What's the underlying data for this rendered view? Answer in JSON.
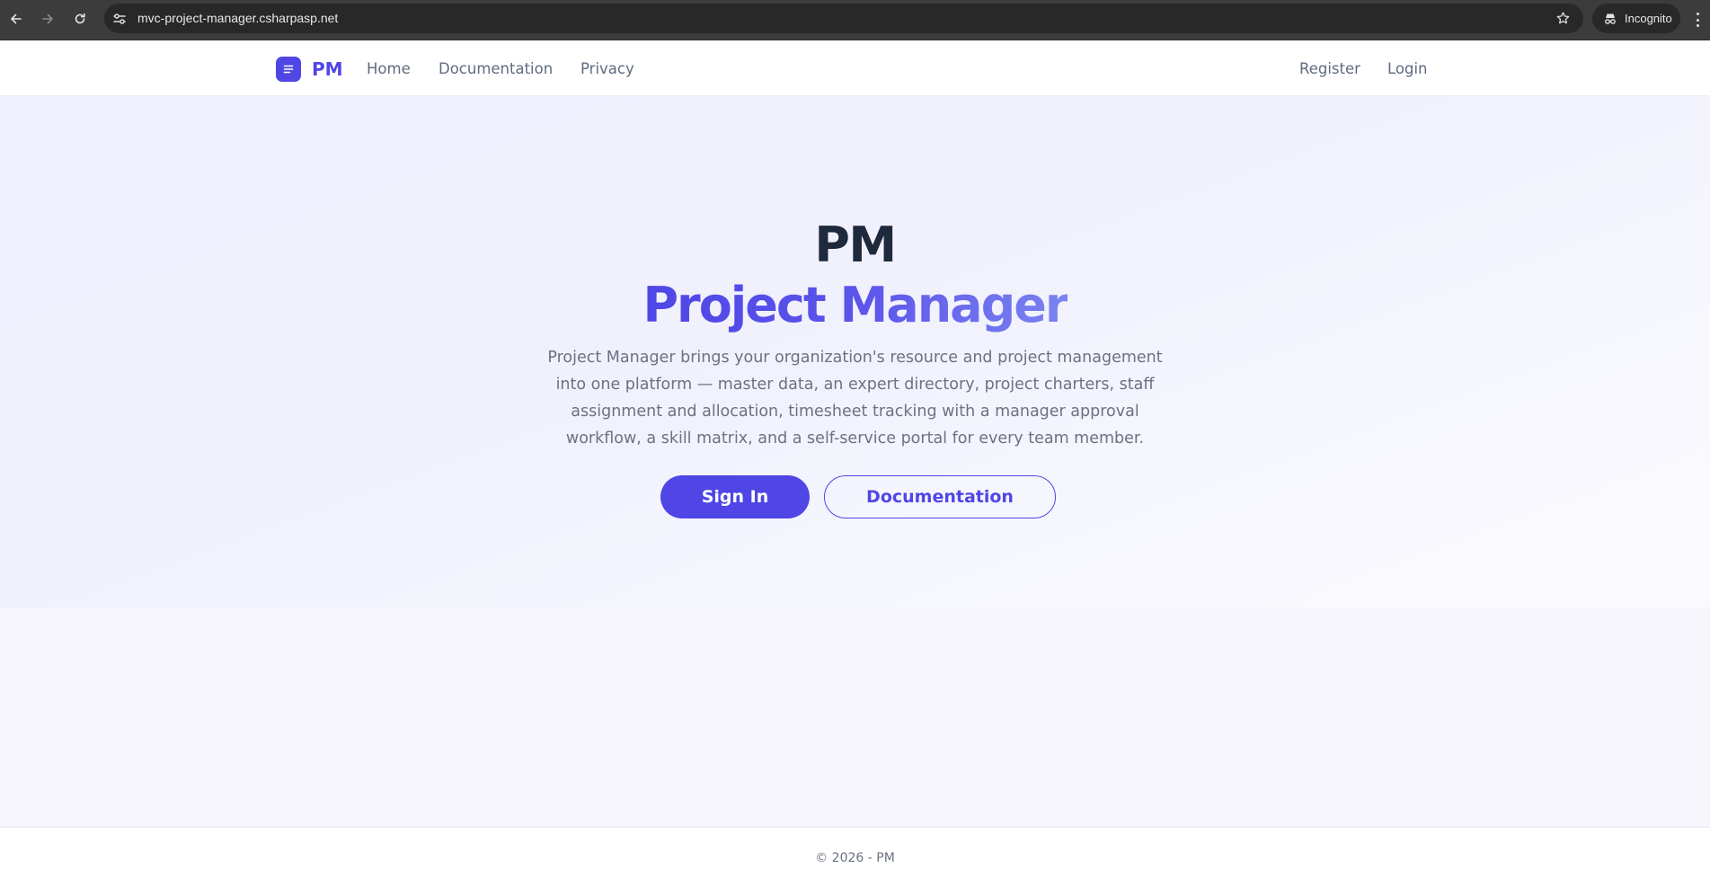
{
  "browser": {
    "url": "mvc-project-manager.csharpasp.net",
    "incognito_label": "Incognito"
  },
  "navbar": {
    "brand": "PM",
    "links": [
      "Home",
      "Documentation",
      "Privacy"
    ],
    "auth_links": [
      "Register",
      "Login"
    ]
  },
  "hero": {
    "title_line1": "PM",
    "title_line2": "Project Manager",
    "description": "Project Manager brings your organization's resource and project management into one platform — master data, an expert directory, project charters, staff assignment and allocation, timesheet tracking with a manager approval workflow, a skill matrix, and a self-service portal for every team member.",
    "primary_button": "Sign In",
    "secondary_button": "Documentation"
  },
  "footer": {
    "text": "© 2026 - PM"
  },
  "colors": {
    "accent": "#4f46e5",
    "heading": "#1e293b",
    "muted_text": "#6b7280",
    "chrome_bg": "#3c3c3c"
  },
  "icons": {
    "back": "arrow-left-icon",
    "forward": "arrow-right-icon",
    "reload": "reload-icon",
    "site_info": "tune-icon",
    "bookmark": "star-icon",
    "incognito": "incognito-icon",
    "menu": "kebab-menu-icon",
    "brand": "menu-lines-icon"
  }
}
